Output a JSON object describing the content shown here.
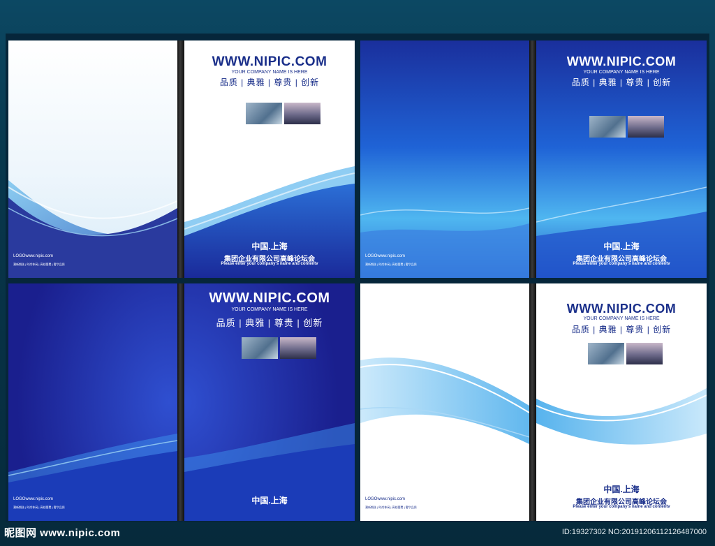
{
  "brand": {
    "url": "WWW.NIPIC.COM",
    "tagline": "YOUR COMPANY NAME IS HERE",
    "slogan": "品质 | 典雅 | 尊贵 | 创新",
    "city": "中国.上海",
    "company": "集团企业有限公司高峰论坛会",
    "prompt": "Please enter your company's name and contentv",
    "logo": "LOGOwww.nipic.com",
    "fine_print": "潮新期选 | 时尚休闲 | 高档奢费 | 奢华品质"
  },
  "colors": {
    "deep_blue": "#1a2a9a",
    "mid_blue": "#1f63d6",
    "light_blue": "#4fb6f0",
    "title_dark": "#1a2f8a"
  },
  "footer": {
    "site": "昵图网 www.nipic.com",
    "id": "ID:19327302 NO:20191206112126487000"
  }
}
